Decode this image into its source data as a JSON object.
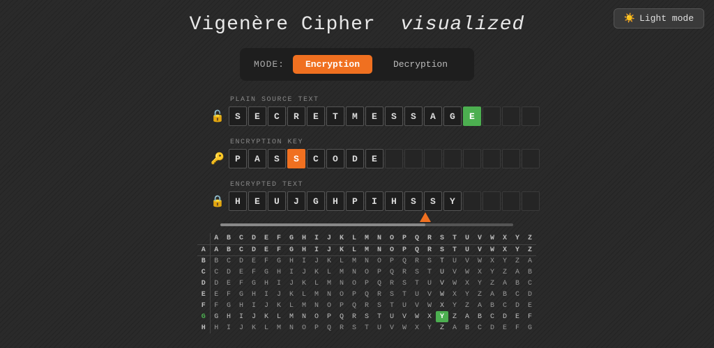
{
  "header": {
    "title_part1": "Vigenère Cipher",
    "title_part2": "visualized",
    "light_mode_label": "Light mode",
    "light_mode_icon": "☀️"
  },
  "mode_bar": {
    "label": "MODE:",
    "encryption_label": "Encryption",
    "decryption_label": "Decryption",
    "active": "Encryption"
  },
  "plain_source": {
    "label": "PLAIN SOURCE TEXT",
    "icon": "🔓",
    "letters": [
      "S",
      "E",
      "C",
      "R",
      "E",
      "T",
      "M",
      "E",
      "S",
      "S",
      "A",
      "G",
      "E"
    ],
    "highlight_index": 12,
    "highlight_color": "green"
  },
  "encryption_key": {
    "label": "ENCRYPTION KEY",
    "icon": "🔑",
    "letters": [
      "P",
      "A",
      "S",
      "S",
      "C",
      "O",
      "D",
      "E"
    ],
    "highlight_index": 3,
    "highlight_color": "orange"
  },
  "encrypted_text": {
    "label": "ENCRYPTED TEXT",
    "icon": "🔒",
    "letters": [
      "H",
      "E",
      "U",
      "J",
      "G",
      "H",
      "P",
      "I",
      "H",
      "S",
      "S",
      "Y"
    ]
  },
  "vigenere": {
    "header_row": [
      "",
      "A",
      "B",
      "C",
      "D",
      "E",
      "F",
      "G",
      "H",
      "I",
      "J",
      "K",
      "L",
      "M",
      "N",
      "O",
      "P",
      "Q",
      "R",
      "S",
      "T",
      "U",
      "V",
      "W",
      "X",
      "Y",
      "Z"
    ],
    "col_highlight": "S",
    "row_highlight": "G",
    "cell_highlight": "Y",
    "rows": [
      [
        "A",
        "A",
        "B",
        "C",
        "D",
        "E",
        "F",
        "G",
        "H",
        "I",
        "J",
        "K",
        "L",
        "M",
        "N",
        "O",
        "P",
        "Q",
        "R",
        "S",
        "T",
        "U",
        "V",
        "W",
        "X",
        "Y",
        "Z"
      ],
      [
        "B",
        "B",
        "C",
        "D",
        "E",
        "F",
        "G",
        "H",
        "I",
        "J",
        "K",
        "L",
        "M",
        "N",
        "O",
        "P",
        "Q",
        "R",
        "S",
        "T",
        "U",
        "V",
        "W",
        "X",
        "Y",
        "Z",
        "A"
      ],
      [
        "C",
        "C",
        "D",
        "E",
        "F",
        "G",
        "H",
        "I",
        "J",
        "K",
        "L",
        "M",
        "N",
        "O",
        "P",
        "Q",
        "R",
        "S",
        "T",
        "U",
        "V",
        "W",
        "X",
        "Y",
        "Z",
        "A",
        "B"
      ],
      [
        "D",
        "D",
        "E",
        "F",
        "G",
        "H",
        "I",
        "J",
        "K",
        "L",
        "M",
        "N",
        "O",
        "P",
        "Q",
        "R",
        "S",
        "T",
        "U",
        "V",
        "W",
        "X",
        "Y",
        "Z",
        "A",
        "B",
        "C"
      ],
      [
        "E",
        "E",
        "F",
        "G",
        "H",
        "I",
        "J",
        "K",
        "L",
        "M",
        "N",
        "O",
        "P",
        "Q",
        "R",
        "S",
        "T",
        "U",
        "V",
        "W",
        "X",
        "Y",
        "Z",
        "A",
        "B",
        "C",
        "D"
      ],
      [
        "F",
        "F",
        "G",
        "H",
        "I",
        "J",
        "K",
        "L",
        "M",
        "N",
        "O",
        "P",
        "Q",
        "R",
        "S",
        "T",
        "U",
        "V",
        "W",
        "X",
        "Y",
        "Z",
        "A",
        "B",
        "C",
        "D",
        "E"
      ],
      [
        "G",
        "G",
        "H",
        "I",
        "J",
        "K",
        "L",
        "M",
        "N",
        "O",
        "P",
        "Q",
        "R",
        "S",
        "T",
        "U",
        "V",
        "W",
        "X",
        "Y",
        "Z",
        "A",
        "B",
        "C",
        "D",
        "E",
        "F"
      ],
      [
        "H",
        "H",
        "I",
        "J",
        "K",
        "L",
        "M",
        "N",
        "O",
        "P",
        "Q",
        "R",
        "S",
        "T",
        "U",
        "V",
        "W",
        "X",
        "Y",
        "Z",
        "A",
        "B",
        "C",
        "D",
        "E",
        "F",
        "G"
      ]
    ]
  }
}
